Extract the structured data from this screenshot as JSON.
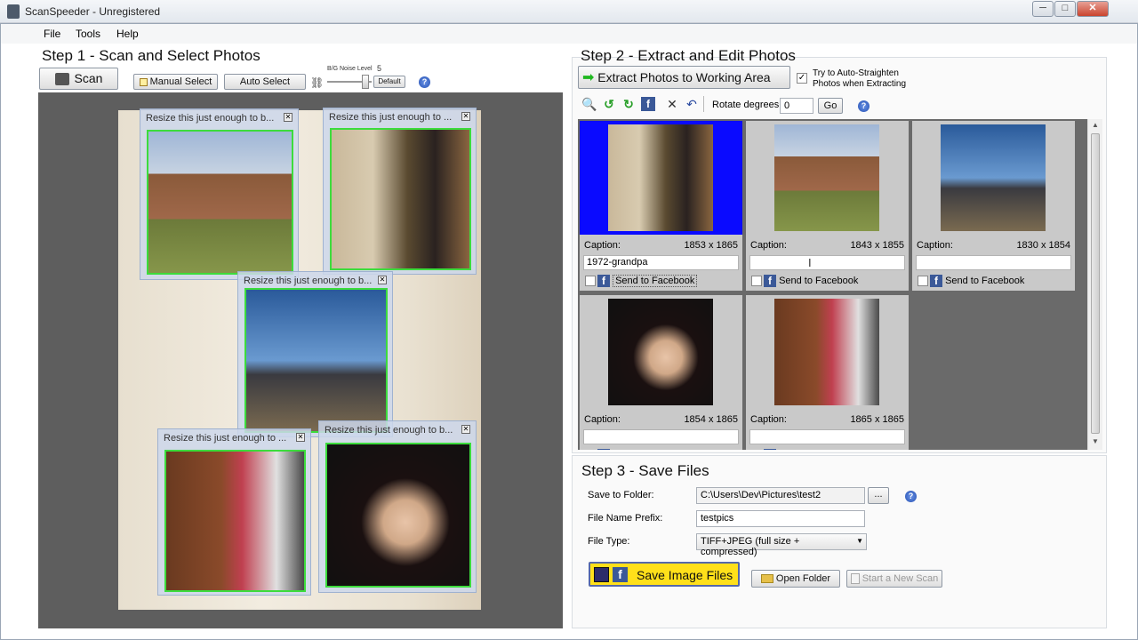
{
  "window": {
    "title": "ScanSpeeder - Unregistered",
    "min_label": "─",
    "max_label": "□",
    "close_label": "✕"
  },
  "menu": [
    "File",
    "Tools",
    "Help"
  ],
  "step1": {
    "title": "Step 1 - Scan and Select Photos",
    "scan_label": "Scan",
    "manual_select_label": "Manual Select",
    "auto_select_label": "Auto Select",
    "noise_label": "B/G Noise Level",
    "noise_value": "5",
    "default_label": "Default",
    "crop_boxes": [
      "Resize this just enough to b...",
      "Resize this just enough to ...",
      "Resize this just enough to b...",
      "Resize this just enough to ...",
      "Resize this just enough to b..."
    ]
  },
  "step2": {
    "title": "Step 2 - Extract and Edit Photos",
    "extract_label": "Extract Photos to Working Area",
    "auto_straighten_label_1": "Try to Auto-Straighten",
    "auto_straighten_label_2": "Photos when Extracting",
    "rotate_label": "Rotate degrees:",
    "rotate_value": "0",
    "go_label": "Go",
    "caption_label": "Caption:",
    "send_fb_label": "Send to Facebook",
    "thumbnails": [
      {
        "size": "1853 x 1865",
        "caption": "1972-grandpa",
        "selected": true
      },
      {
        "size": "1843 x 1855",
        "caption": "",
        "selected": false
      },
      {
        "size": "1830 x 1854",
        "caption": "",
        "selected": false
      },
      {
        "size": "1854 x 1865",
        "caption": "",
        "selected": false
      },
      {
        "size": "1865 x 1865",
        "caption": "",
        "selected": false
      }
    ]
  },
  "step3": {
    "title": "Step 3 - Save Files",
    "save_folder_label": "Save to Folder:",
    "save_folder_value": "C:\\Users\\Dev\\Pictures\\test2",
    "browse_label": "...",
    "prefix_label": "File Name Prefix:",
    "prefix_value": "testpics",
    "type_label": "File Type:",
    "type_value": "TIFF+JPEG (full size + compressed)",
    "save_label": "Save Image Files",
    "open_folder_label": "Open Folder",
    "new_scan_label": "Start a New Scan"
  },
  "colors": {
    "selection_blue": "#0a0aff",
    "crop_green": "#3cdc3c",
    "save_yellow": "#ffe01a",
    "facebook_blue": "#3b5998"
  }
}
